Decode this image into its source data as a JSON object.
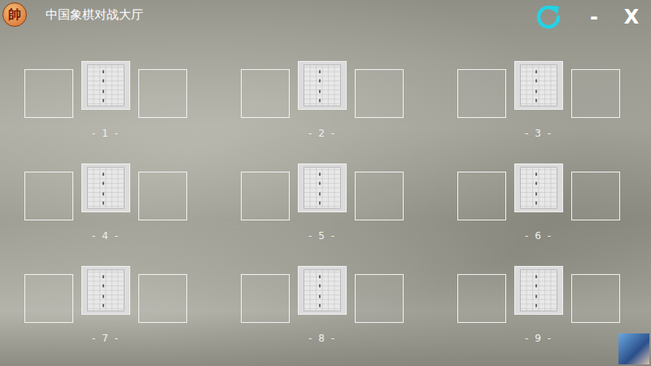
{
  "window": {
    "title": "中国象棋对战大厅",
    "logo": "帥"
  },
  "controls": {
    "minimize": "-",
    "close": "X"
  },
  "tables": [
    {
      "label": "- 1 -"
    },
    {
      "label": "- 2 -"
    },
    {
      "label": "- 3 -"
    },
    {
      "label": "- 4 -"
    },
    {
      "label": "- 5 -"
    },
    {
      "label": "- 6 -"
    },
    {
      "label": "- 7 -"
    },
    {
      "label": "- 8 -"
    },
    {
      "label": "- 9 -"
    }
  ]
}
